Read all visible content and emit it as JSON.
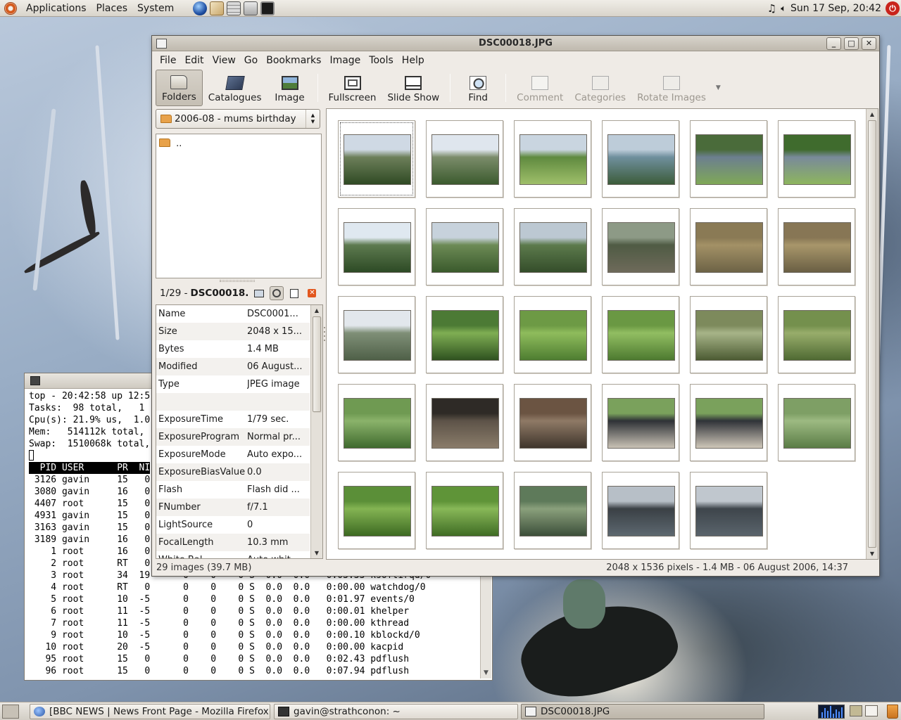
{
  "top_panel": {
    "menus": [
      "Applications",
      "Places",
      "System"
    ],
    "launchers": [
      "web-browser-icon",
      "mail-icon",
      "calculator-icon",
      "network-icon",
      "terminal-icon"
    ],
    "clock": "Sun 17 Sep, 20:42"
  },
  "terminal": {
    "lines": [
      "top - 20:42:58 up 12:5",
      "Tasks:  98 total,   1",
      "Cpu(s): 21.9% us,  1.0",
      "Mem:   514112k total,",
      "Swap:  1510068k total,"
    ],
    "header": "  PID USER      PR  NI",
    "partial_rows": [
      " 3126 gavin     15   0",
      " 3080 gavin     16   0",
      " 4407 root      15   0",
      " 4931 gavin     15   0",
      " 3163 gavin     15   0",
      " 3189 gavin     16   0",
      "    1 root      16   0",
      "    2 root      RT   0",
      "    3 root      34  19      0    0    0 S  0.0  0.0   0:03.33 ksoftirqd/0"
    ],
    "rows": [
      "    4 root      RT   0      0    0    0 S  0.0  0.0   0:00.00 watchdog/0",
      "    5 root      10  -5      0    0    0 S  0.0  0.0   0:01.97 events/0",
      "    6 root      11  -5      0    0    0 S  0.0  0.0   0:00.01 khelper",
      "    7 root      11  -5      0    0    0 S  0.0  0.0   0:00.00 kthread",
      "    9 root      10  -5      0    0    0 S  0.0  0.0   0:00.10 kblockd/0",
      "   10 root      20  -5      0    0    0 S  0.0  0.0   0:00.00 kacpid",
      "   95 root      15   0      0    0    0 S  0.0  0.0   0:02.43 pdflush",
      "   96 root      15   0      0    0    0 S  0.0  0.0   0:07.94 pdflush"
    ]
  },
  "gthumb": {
    "title": "DSC00018.JPG",
    "menu": [
      "File",
      "Edit",
      "View",
      "Go",
      "Bookmarks",
      "Image",
      "Tools",
      "Help"
    ],
    "toolbar": {
      "folders": "Folders",
      "catalogues": "Catalogues",
      "image": "Image",
      "fullscreen": "Fullscreen",
      "slideshow": "Slide Show",
      "find": "Find",
      "comment": "Comment",
      "categories": "Categories",
      "rotate": "Rotate Images"
    },
    "current_folder": "2006-08 - mums birthday",
    "folder_items": [
      ".."
    ],
    "image_counter": "1/29 - ",
    "image_name": "DSC00018.",
    "properties": [
      {
        "key": "Name",
        "value": "DSC0001..."
      },
      {
        "key": "Size",
        "value": "2048 x 15..."
      },
      {
        "key": "Bytes",
        "value": "1.4 MB"
      },
      {
        "key": "Modified",
        "value": "06 August..."
      },
      {
        "key": "Type",
        "value": "JPEG image"
      },
      {
        "key": "",
        "value": ""
      },
      {
        "key": "ExposureTime",
        "value": "1/79 sec."
      },
      {
        "key": "ExposureProgram",
        "value": "Normal pr..."
      },
      {
        "key": "ExposureMode",
        "value": "Auto expo..."
      },
      {
        "key": "ExposureBiasValue",
        "value": "0.0"
      },
      {
        "key": "Flash",
        "value": "Flash did ..."
      },
      {
        "key": "FNumber",
        "value": "f/7.1"
      },
      {
        "key": "LightSource",
        "value": "0"
      },
      {
        "key": "FocalLength",
        "value": "10.3 mm"
      },
      {
        "key": "White Bal...",
        "value": "Auto whit..."
      }
    ],
    "status_left": "29 images (39.7 MB)",
    "status_right": "2048 x 1536 pixels - 1.4 MB - 06 August 2006, 14:37",
    "thumbnails": [
      "valley-hills",
      "waterfall-hillside",
      "river-meadow",
      "river-bend",
      "river-water",
      "river-grass",
      "valley-trees",
      "hillside-sheep",
      "hillside-stream",
      "stone-bridge",
      "rippled-sand",
      "rippled-sand-2",
      "bracken",
      "ferns",
      "grass-bluebell",
      "grass-bluebell-2",
      "heather",
      "heather-2",
      "green-slope",
      "rock-pool",
      "rocky-stream",
      "car-person",
      "car-person-2",
      "green-field",
      "yellow-flower",
      "yellow-flower-2",
      "gorge-river",
      "loch-dusk",
      "loch-hills"
    ]
  },
  "bottom_panel": {
    "tasks": [
      "[BBC NEWS | News Front Page - Mozilla Firefox]",
      "gavin@strathconon: ~",
      "DSC00018.JPG"
    ]
  }
}
